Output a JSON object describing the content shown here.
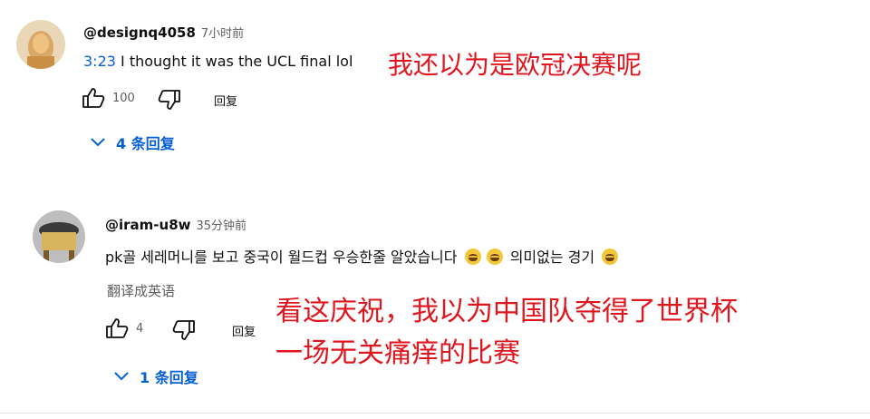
{
  "comments": [
    {
      "handle": "@designq4058",
      "time": "7小时前",
      "timestamp_link": "3:23",
      "text": "I thought it was the UCL final lol",
      "likes": "100",
      "reply_label": "回复",
      "replies_label": "4 条回复",
      "annotation": "我还以为是欧冠决赛呢"
    },
    {
      "handle": "@iram-u8w",
      "time": "35分钟前",
      "text_before_emoji": "pk골 세레머니를 보고 중국이 월드컵 우승한줄 알았습니다",
      "text_after_emoji": "의미없는 경기",
      "translate_label": "翻译成英语",
      "likes": "4",
      "reply_label": "回复",
      "replies_label": "1 条回复",
      "annotation_line1": "看这庆祝，我以为中国队夺得了世界杯",
      "annotation_line2": "一场无关痛痒的比赛"
    }
  ],
  "colors": {
    "link_blue": "#065fd4",
    "annotation_red": "#e0161f",
    "secondary_text": "#606060"
  },
  "icons": [
    "thumbs-up-icon",
    "thumbs-down-icon",
    "chevron-down-icon",
    "laughing-emoji-icon"
  ]
}
